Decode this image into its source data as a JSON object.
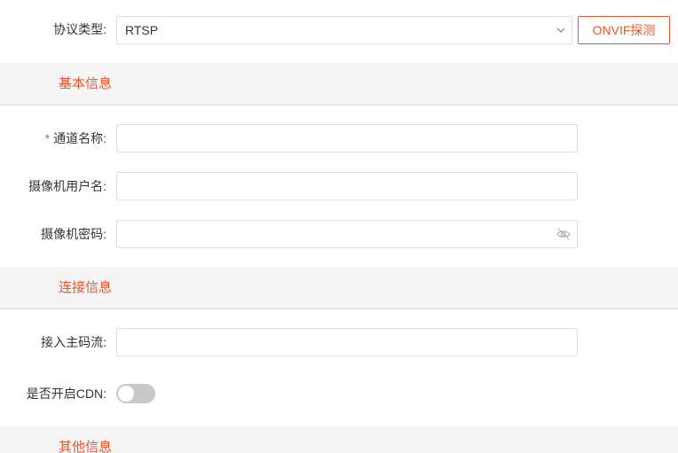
{
  "protocol": {
    "label": "协议类型:",
    "value": "RTSP",
    "probe_button": "ONVIF探测"
  },
  "sections": {
    "basic": "基本信息",
    "connection": "连接信息",
    "other": "其他信息"
  },
  "fields": {
    "channel_name": {
      "label": "通道名称:",
      "required_mark": "*",
      "value": ""
    },
    "camera_username": {
      "label": "摄像机用户名:",
      "value": ""
    },
    "camera_password": {
      "label": "摄像机密码:",
      "value": ""
    },
    "main_stream": {
      "label": "接入主码流:",
      "value": ""
    },
    "cdn": {
      "label": "是否开启CDN:",
      "enabled": false
    }
  },
  "colors": {
    "accent": "#e8542c",
    "section_bg": "#f5f5f5",
    "border": "#dcdfe6",
    "toggle_off": "#c8c8c8"
  },
  "icons": {
    "dropdown": "chevron-down-icon",
    "password_visibility": "eye-off-icon"
  }
}
